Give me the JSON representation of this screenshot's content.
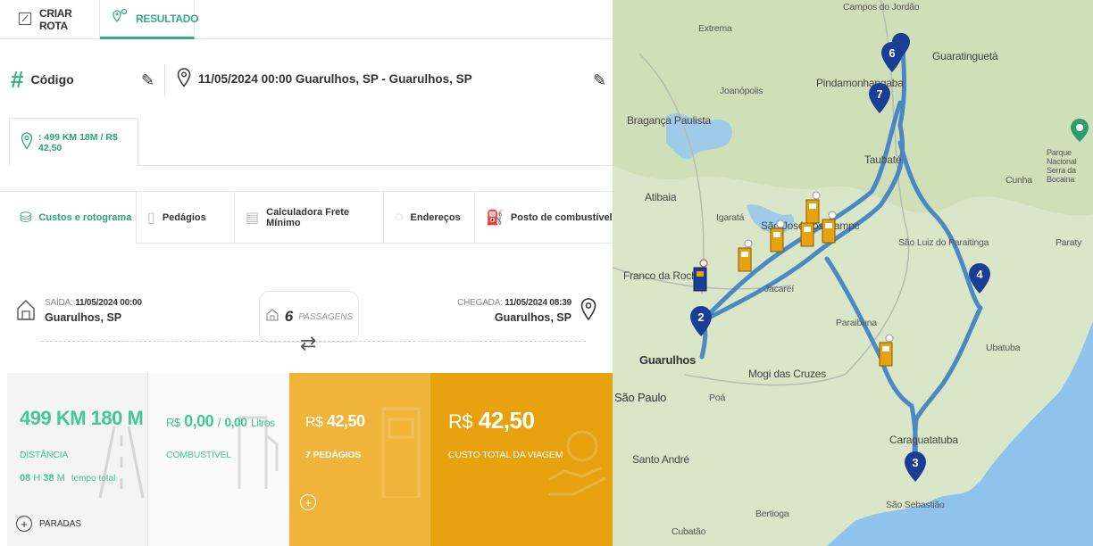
{
  "tabs": {
    "create_route": "CRIAR ROTA",
    "result": "RESULTADO"
  },
  "header": {
    "code_label": "Código",
    "route_summary": "11/05/2024 00:00 Guarulhos, SP - Guarulhos, SP"
  },
  "summary_tab": ": 499 KM 18M / R$ 42,50",
  "section_tabs": [
    {
      "label": "Custos e rotograma",
      "icon": "route-money-icon"
    },
    {
      "label": "Pedágios",
      "icon": "toll-icon"
    },
    {
      "label": "Calculadora Frete Mínimo",
      "icon": "calculator-icon"
    },
    {
      "label": "Endereços",
      "icon": "location-pin-icon"
    },
    {
      "label": "Posto de combustível",
      "icon": "fuel-icon"
    }
  ],
  "trip": {
    "departure_label": "SAÍDA:",
    "departure_time": "11/05/2024 00:00",
    "departure_place": "Guarulhos, SP",
    "passes_count": "6",
    "passes_label": "PASSAGENS",
    "arrival_label": "CHEGADA:",
    "arrival_time": "11/05/2024 08:39",
    "arrival_place": "Guarulhos, SP"
  },
  "cards": {
    "distance": {
      "value": "499 KM 180 M",
      "label": "DISTÂNCIA",
      "hours": "08",
      "h_unit": "H",
      "minutes": "38",
      "m_unit": "M",
      "time_label": "tempo total",
      "stops_label": "PARADAS"
    },
    "fuel": {
      "currency": "R$",
      "value": "0,00",
      "separator": "/",
      "liters": "0,00",
      "liters_unit": "Litros",
      "label": "COMBUSTÍVEL"
    },
    "tolls": {
      "currency": "R$",
      "value": "42,50",
      "count_label": "7 PEDÁGIOS"
    },
    "total": {
      "currency": "R$",
      "value": "42,50",
      "label": "CUSTO TOTAL DA VIAGEM"
    }
  },
  "map": {
    "labels": [
      "Campos do Jordão",
      "Extrema",
      "Joanópolis",
      "Guaratinguetá",
      "Pindamonhangaba",
      "Bragança Paulista",
      "Taubaté",
      "Atibaia",
      "Parque Nacional Serra da Bocaina",
      "Cunha",
      "Igaratá",
      "São José dos Campos",
      "São Luiz do Paraitinga",
      "Paraty",
      "Franco da Rocha",
      "Jacareí",
      "Guarulhos",
      "Paraibuna",
      "Mogi das Cruzes",
      "São Paulo",
      "Poá",
      "Caraguatatuba",
      "Santo André",
      "Bertioga",
      "Cubatão",
      "São Sebastião",
      "Ubatuba"
    ],
    "markers": [
      "2",
      "3",
      "4",
      "6",
      "7"
    ],
    "route_color": "#3b7fc4",
    "accent_green": "#2aa27e",
    "card_orange": "#e8a20f"
  }
}
